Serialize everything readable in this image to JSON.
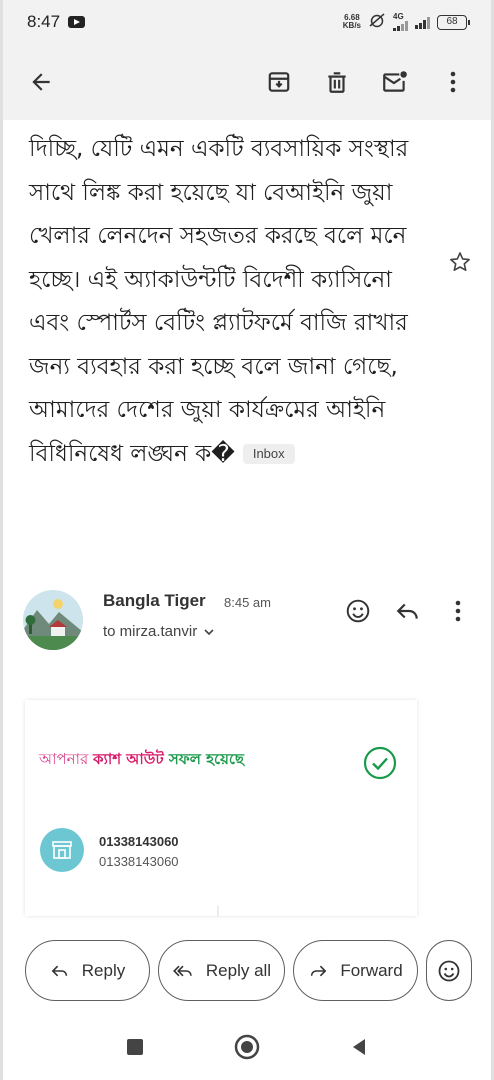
{
  "status_bar": {
    "time": "8:47",
    "net_speed_value": "6.68",
    "net_speed_unit": "KB/s",
    "network_type": "4G",
    "battery": "68"
  },
  "toolbar": {
    "icons": [
      "back-arrow-icon",
      "archive-icon",
      "delete-icon",
      "mark-unread-icon",
      "more-vert-icon"
    ]
  },
  "email": {
    "body_text": "দিচ্ছি, যেটি এমন একটি ব্যবসায়িক সংস্থার সাথে লিঙ্ক করা হয়েছে যা বেআইনি জুয়া খেলার লেনদেন সহজতর করছে বলে মনে হচ্ছে। এই অ্যাকাউন্টটি বিদেশী ক্যাসিনো এবং স্পোর্টস বেটিং প্ল্যাটফর্মে বাজি রাখার জন্য ব্যবহার করা হচ্ছে বলে জানা গেছে, আমাদের দেশের জুয়া কার্যক্রমের আইনি বিধিনিষেধ লঙ্ঘন ক�",
    "label": "Inbox"
  },
  "sender": {
    "name": "Bangla Tiger",
    "time": "8:45 am",
    "recipient": "to mirza.tanvir"
  },
  "card": {
    "title_part1": "আপনার ",
    "title_part2": "ক্যাশ আউট",
    "title_part3": " সফল হয়েছে",
    "account_number": "01338143060",
    "account_sub": "01338143060",
    "colors": {
      "pink": "#d91a6a",
      "green": "#1a9a4a",
      "teal": "#6cc7d3"
    }
  },
  "actions": {
    "reply": "Reply",
    "reply_all": "Reply all",
    "forward": "Forward"
  }
}
